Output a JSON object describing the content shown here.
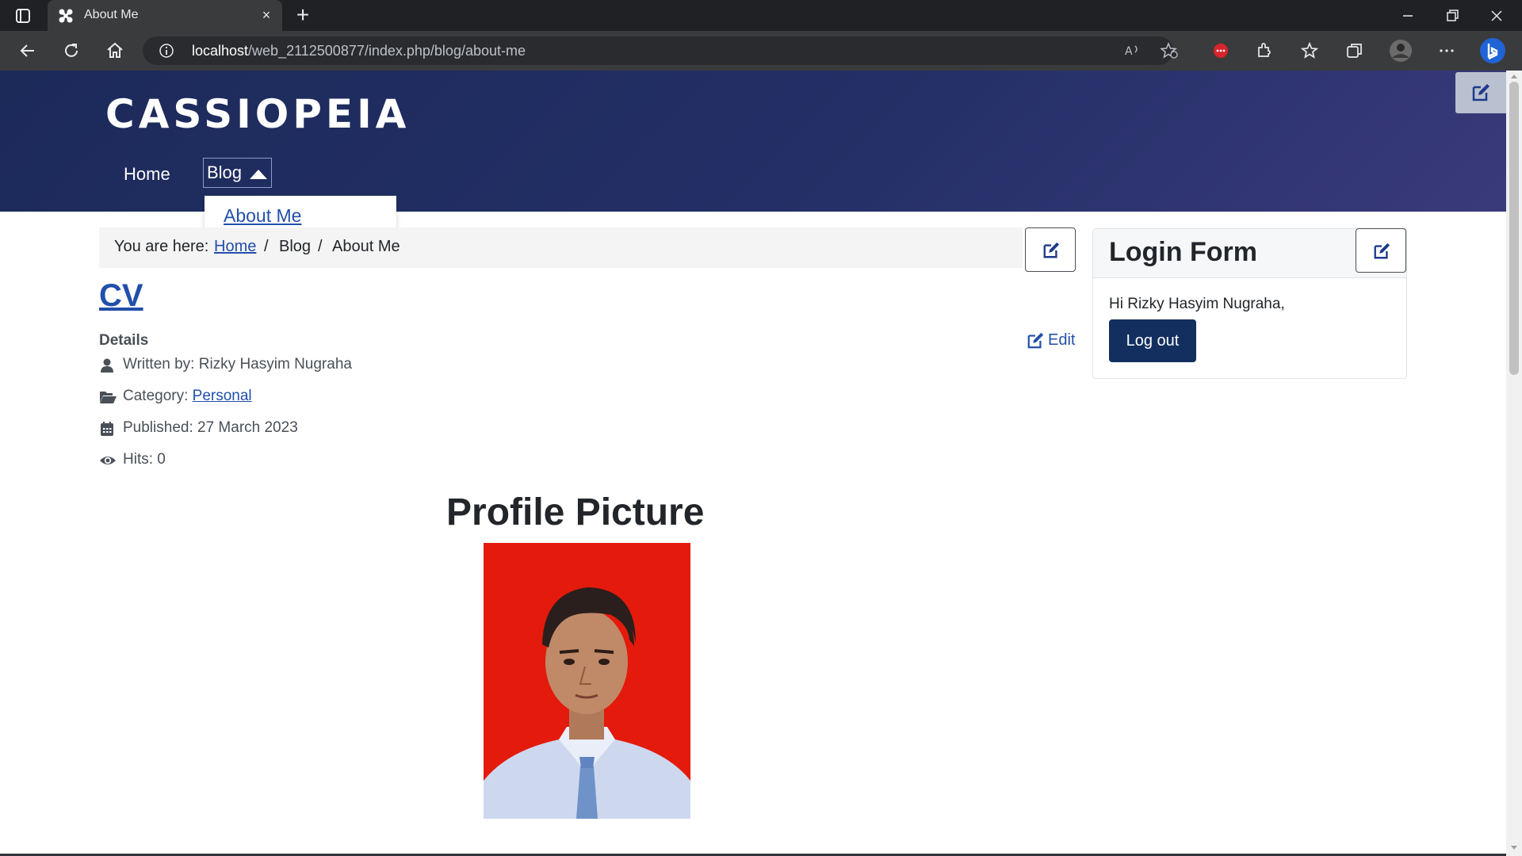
{
  "browser": {
    "tab_title": "About Me",
    "address_host": "localhost",
    "address_path": "/web_2112500877/index.php/blog/about-me",
    "tab_close_glyph": "×",
    "new_tab_glyph": "+"
  },
  "site": {
    "brand": "CASSIOPEIA",
    "nav": {
      "home": "Home",
      "blog": "Blog"
    },
    "dropdown": {
      "about_me": "About Me"
    }
  },
  "breadcrumb": {
    "prefix": "You are here:",
    "home": "Home",
    "sep": "/",
    "blog": "Blog",
    "current": "About Me"
  },
  "article": {
    "title": "CV",
    "details_label": "Details",
    "edit_link": "Edit",
    "written_by": "Written by: Rizky Hasyim Nugraha",
    "category_label": "Category:",
    "category_value": "Personal",
    "published": "Published: 27 March 2023",
    "hits": "Hits: 0",
    "profile_heading": "Profile Picture"
  },
  "login": {
    "title": "Login Form",
    "greeting": "Hi Rizky Hasyim Nugraha,",
    "logout": "Log out"
  },
  "colors": {
    "header_start": "#1c2a5a",
    "header_end": "#3a3a7a",
    "link": "#224faa",
    "logout_bg": "#132f5f",
    "photo_bg": "#e41a0c"
  }
}
